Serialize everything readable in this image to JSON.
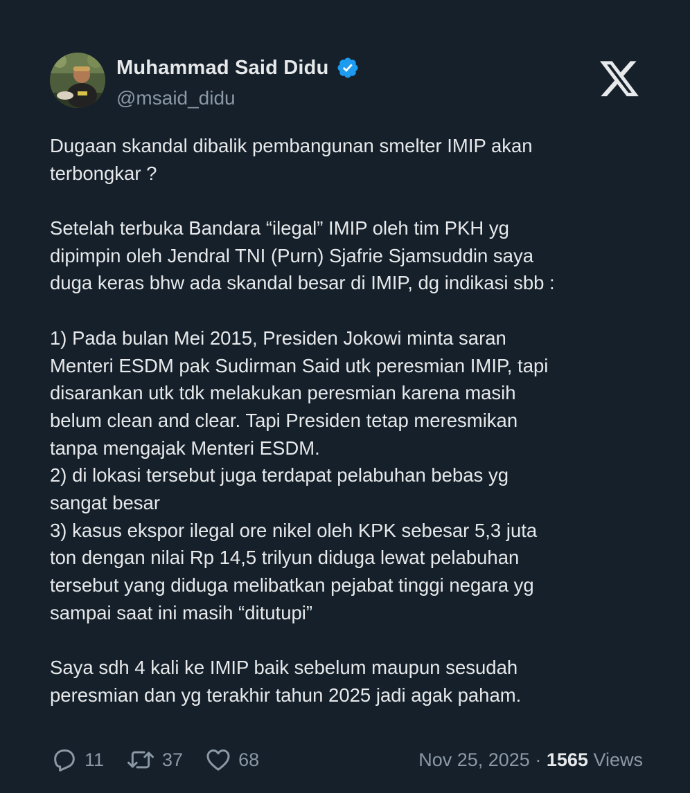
{
  "author": {
    "display_name": "Muhammad Said Didu",
    "handle": "@msaid_didu",
    "verified_icon": "verified-badge-icon",
    "avatar_icon": "avatar"
  },
  "brand": {
    "logo": "x-logo-icon"
  },
  "tweet": {
    "lines": [
      "Dugaan skandal dibalik pembangunan smelter IMIP akan",
      "terbongkar ?",
      "",
      "Setelah terbuka Bandara “ilegal” IMIP oleh tim PKH yg",
      "dipimpin oleh Jendral TNI (Purn) Sjafrie Sjamsuddin saya",
      "duga keras bhw ada skandal besar di IMIP, dg indikasi sbb :",
      "",
      "1) Pada bulan Mei 2015, Presiden Jokowi minta saran",
      "Menteri ESDM pak Sudirman Said utk peresmian IMIP, tapi",
      "disarankan utk tdk melakukan peresmian karena masih",
      "belum clean and clear. Tapi Presiden tetap meresmikan",
      "tanpa mengajak Menteri ESDM.",
      "2) di lokasi tersebut juga terdapat pelabuhan bebas yg",
      "sangat besar",
      "3) kasus ekspor ilegal ore nikel oleh KPK sebesar 5,3 juta",
      "ton dengan nilai Rp 14,5 trilyun diduga lewat pelabuhan",
      "tersebut yang diduga melibatkan pejabat tinggi negara yg",
      "sampai saat ini masih “ditutupi”",
      "",
      "Saya sdh 4 kali ke IMIP baik sebelum maupun sesudah",
      "peresmian dan yg terakhir tahun 2025 jadi agak paham."
    ]
  },
  "stats": {
    "replies": "11",
    "reposts": "37",
    "likes": "68"
  },
  "meta": {
    "date": "Nov 25, 2025",
    "separator": "·",
    "views_count": "1565",
    "views_label": "Views"
  },
  "colors": {
    "background": "#15202b",
    "text_primary": "#e7e9ea",
    "text_secondary": "#8b98a5",
    "verified": "#1d9bf0"
  }
}
